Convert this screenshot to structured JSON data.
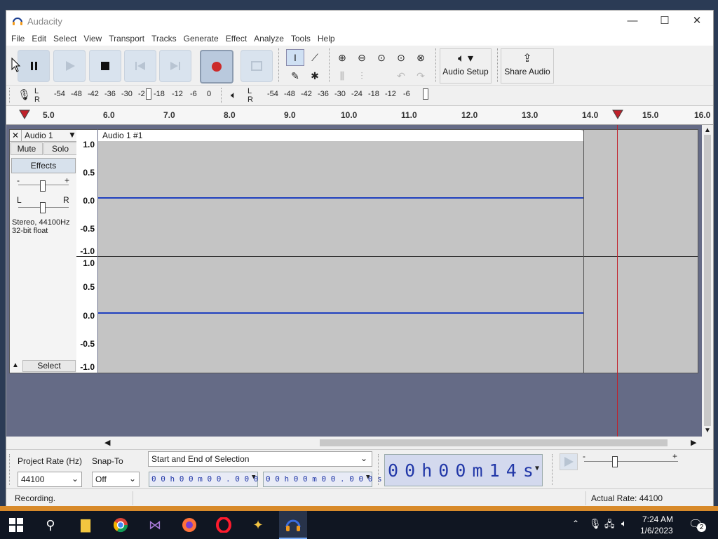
{
  "window": {
    "title": "Audacity",
    "controls": {
      "minimize": "—",
      "maximize": "☐",
      "close": "✕"
    }
  },
  "menu": [
    "File",
    "Edit",
    "Select",
    "View",
    "Transport",
    "Tracks",
    "Generate",
    "Effect",
    "Analyze",
    "Tools",
    "Help"
  ],
  "toolbar": {
    "audio_setup_label": "Audio Setup",
    "share_audio_label": "Share Audio"
  },
  "meters": {
    "record_lr": "L\nR",
    "record_scale": [
      "-54",
      "-48",
      "-42",
      "-36",
      "-30",
      "-2",
      "-18",
      "-12",
      "-6",
      "0"
    ],
    "play_lr": "L\nR",
    "play_scale": [
      "-54",
      "-48",
      "-42",
      "-36",
      "-30",
      "-24",
      "-18",
      "-12",
      "-6"
    ]
  },
  "ruler": {
    "ticks": [
      "5.0",
      "6.0",
      "7.0",
      "8.0",
      "9.0",
      "10.0",
      "11.0",
      "12.0",
      "13.0",
      "14.0",
      "15.0",
      "16.0"
    ]
  },
  "track": {
    "name": "Audio 1",
    "clip_name": "Audio 1 #1",
    "mute_label": "Mute",
    "solo_label": "Solo",
    "effects_label": "Effects",
    "gain_minus": "-",
    "gain_plus": "+",
    "pan_left": "L",
    "pan_right": "R",
    "info_line1": "Stereo, 44100Hz",
    "info_line2": "32-bit float",
    "select_label": "Select",
    "scale": [
      "1.0",
      "0.5",
      "0.0",
      "-0.5",
      "-1.0"
    ]
  },
  "bottom": {
    "project_rate_label": "Project Rate (Hz)",
    "project_rate_value": "44100",
    "snap_to_label": "Snap-To",
    "snap_to_value": "Off",
    "selection_mode": "Start and End of Selection",
    "selection_start": "0 0 h 0 0 m 0 0 . 0 0 0 s",
    "selection_end": "0 0 h 0 0 m 0 0 . 0 0 0 s",
    "time_display": "0 0 h 0 0 m 1 4 s",
    "speed_minus": "-",
    "speed_plus": "+"
  },
  "status": {
    "left": "Recording.",
    "right": "Actual Rate: 44100"
  },
  "taskbar": {
    "time": "7:24 AM",
    "date": "1/6/2023",
    "notifications": "2"
  },
  "colors": {
    "waveform": "#1f3fbf",
    "playhead": "#c0202a",
    "track_bg": "#c4c4c4",
    "empty_area": "#656b86"
  }
}
